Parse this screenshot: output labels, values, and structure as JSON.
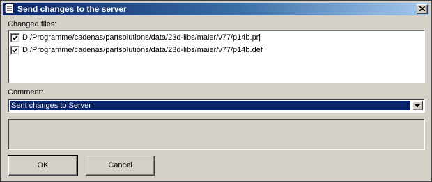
{
  "window": {
    "title": "Send changes to the server",
    "icon": "document-icon",
    "close_icon": "close-icon"
  },
  "changed_files": {
    "label": "Changed files:",
    "items": [
      {
        "checked": true,
        "path": "D:/Programme/cadenas/partsolutions/data/23d-libs/maier/v77/p14b.prj"
      },
      {
        "checked": true,
        "path": "D:/Programme/cadenas/partsolutions/data/23d-libs/maier/v77/p14b.def"
      }
    ]
  },
  "comment": {
    "label": "Comment:",
    "value": "Sent changes to Server"
  },
  "buttons": {
    "ok": "OK",
    "cancel": "Cancel"
  },
  "colors": {
    "title_bar_start": "#0a246a",
    "title_bar_end": "#a6caf0",
    "selection": "#0a246a",
    "face": "#d4d0c8"
  }
}
